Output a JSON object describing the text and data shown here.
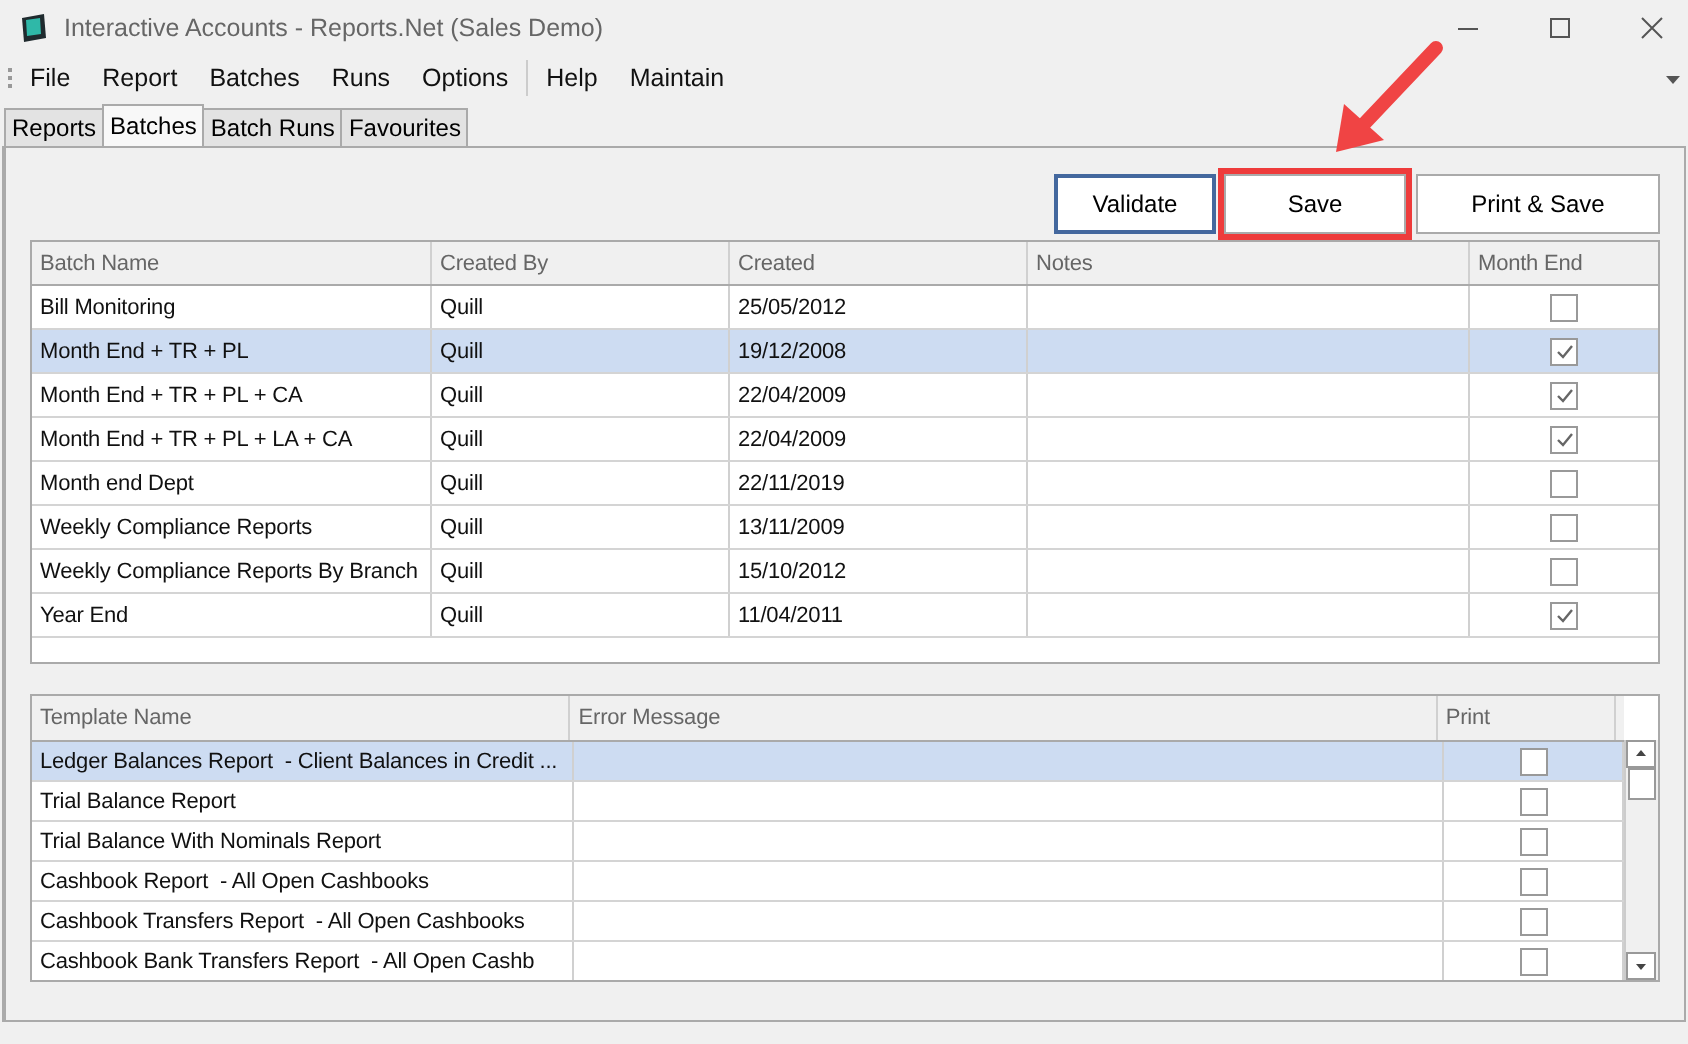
{
  "window": {
    "title": "Interactive Accounts - Reports.Net (Sales Demo)"
  },
  "menu": [
    "File",
    "Report",
    "Batches",
    "Runs",
    "Options",
    "Help",
    "Maintain"
  ],
  "tabs": [
    {
      "label": "Reports",
      "selected": false
    },
    {
      "label": "Batches",
      "selected": true
    },
    {
      "label": "Batch Runs",
      "selected": false
    },
    {
      "label": "Favourites",
      "selected": false
    }
  ],
  "buttons": [
    {
      "label": "Validate",
      "highlighted": false
    },
    {
      "label": "Save",
      "highlighted": true
    },
    {
      "label": "Print & Save",
      "highlighted": false
    }
  ],
  "callout_arrow": true,
  "batches": {
    "columns": [
      "Batch Name",
      "Created By",
      "Created",
      "Notes",
      "Month End"
    ],
    "rows": [
      {
        "name": "Bill Monitoring",
        "created_by": "Quill",
        "created": "25/05/2012",
        "month_end": false,
        "selected": false
      },
      {
        "name": "Month End + TR + PL",
        "created_by": "Quill",
        "created": "19/12/2008",
        "month_end": true,
        "selected": true
      },
      {
        "name": "Month End + TR + PL + CA",
        "created_by": "Quill",
        "created": "22/04/2009",
        "month_end": true,
        "selected": false
      },
      {
        "name": "Month End + TR + PL + LA + CA",
        "created_by": "Quill",
        "created": "22/04/2009",
        "month_end": true,
        "selected": false
      },
      {
        "name": "Month end Dept",
        "created_by": "Quill",
        "created": "22/11/2019",
        "month_end": false,
        "selected": false
      },
      {
        "name": "Weekly Compliance Reports",
        "created_by": "Quill",
        "created": "13/11/2009",
        "month_end": false,
        "selected": false
      },
      {
        "name": "Weekly Compliance Reports By Branch",
        "created_by": "Quill",
        "created": "15/10/2012",
        "month_end": false,
        "selected": false
      },
      {
        "name": "Year End",
        "created_by": "Quill",
        "created": "11/04/2011",
        "month_end": true,
        "selected": false
      }
    ]
  },
  "templates": {
    "columns": [
      "Template Name",
      "Error Message",
      "Print"
    ],
    "rows": [
      {
        "name": "Ledger Balances Report  - Client Balances in Credit ...",
        "print": false,
        "selected": true
      },
      {
        "name": "Trial Balance Report",
        "print": false,
        "selected": false
      },
      {
        "name": "Trial Balance With Nominals Report",
        "print": false,
        "selected": false
      },
      {
        "name": "Cashbook Report  - All Open Cashbooks",
        "print": false,
        "selected": false
      },
      {
        "name": "Cashbook Transfers Report  - All Open Cashbooks",
        "print": false,
        "selected": false
      },
      {
        "name": "Cashbook Bank Transfers Report  - All Open Cashb",
        "print": false,
        "selected": false
      }
    ]
  }
}
